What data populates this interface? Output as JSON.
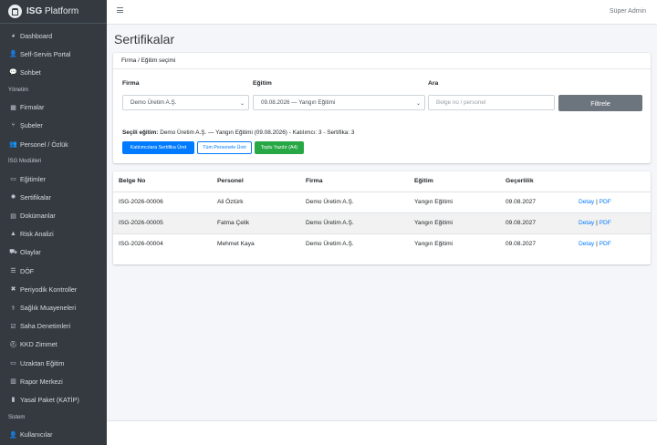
{
  "brand": {
    "name": "ISG",
    "suffix": "Platform"
  },
  "sidebar": {
    "entries": [
      {
        "type": "item",
        "icon": "dashboard-icon",
        "glyph": "◕",
        "label": "Dashboard"
      },
      {
        "type": "item",
        "icon": "user-cog-icon",
        "glyph": "👤",
        "label": "Self-Servis Portal"
      },
      {
        "type": "item",
        "icon": "chat-icon",
        "glyph": "💬",
        "label": "Sohbet"
      },
      {
        "type": "header",
        "label": "Yönetim"
      },
      {
        "type": "item",
        "icon": "building-icon",
        "glyph": "▦",
        "label": "Firmalar"
      },
      {
        "type": "item",
        "icon": "branch-icon",
        "glyph": "⑂",
        "label": "Şubeler"
      },
      {
        "type": "item",
        "icon": "users-icon",
        "glyph": "👥",
        "label": "Personel / Özlük"
      },
      {
        "type": "header",
        "label": "İSG Modülleri"
      },
      {
        "type": "item",
        "icon": "chalkboard-icon",
        "glyph": "▭",
        "label": "Eğitimler"
      },
      {
        "type": "item",
        "icon": "certificate-icon",
        "glyph": "✹",
        "label": "Sertifikalar"
      },
      {
        "type": "item",
        "icon": "document-icon",
        "glyph": "▤",
        "label": "Dokümanlar"
      },
      {
        "type": "item",
        "icon": "warning-icon",
        "glyph": "▲",
        "label": "Risk Analizi"
      },
      {
        "type": "item",
        "icon": "ambulance-icon",
        "glyph": "⛟",
        "label": "Olaylar"
      },
      {
        "type": "item",
        "icon": "list-icon",
        "glyph": "☰",
        "label": "DÖF"
      },
      {
        "type": "item",
        "icon": "tools-icon",
        "glyph": "✖",
        "label": "Periyodik Kontroller"
      },
      {
        "type": "item",
        "icon": "stethoscope-icon",
        "glyph": "⚕",
        "label": "Sağlık Muayeneleri"
      },
      {
        "type": "item",
        "icon": "clipboard-check-icon",
        "glyph": "☑",
        "label": "Saha Denetimleri"
      },
      {
        "type": "item",
        "icon": "hard-hat-icon",
        "glyph": "⛑",
        "label": "KKD Zimmet"
      },
      {
        "type": "item",
        "icon": "laptop-icon",
        "glyph": "▭",
        "label": "Uzaktan Eğitim"
      },
      {
        "type": "item",
        "icon": "chart-icon",
        "glyph": "▥",
        "label": "Rapor Merkezi"
      },
      {
        "type": "item",
        "icon": "file-icon",
        "glyph": "▮",
        "label": "Yasal Paket (KATİP)"
      },
      {
        "type": "header",
        "label": "Sistem"
      },
      {
        "type": "item",
        "icon": "user-gear-icon",
        "glyph": "👤",
        "label": "Kullanıcılar"
      }
    ]
  },
  "topbar": {
    "user": "Süper Admin"
  },
  "page": {
    "title": "Sertifikalar"
  },
  "filter": {
    "header": "Firma / Eğitim seçimi",
    "firma_label": "Firma",
    "firma_value": "Demo Üretim A.Ş.",
    "egitim_label": "Eğitim",
    "egitim_value": "09.08.2026 — Yangın Eğitimi",
    "ara_label": "Ara",
    "ara_placeholder": "Belge no / personel",
    "filter_button": "Filtrele"
  },
  "selection": {
    "label": "Seçili eğitim:",
    "text": "Demo Üretim A.Ş. — Yangın Eğitimi (09.08.2026) - Katılımcı: 3 - Sertifika: 3"
  },
  "actions": {
    "generate_participants": "Katılımcılara Sertifika Üret",
    "generate_all": "Tüm Personele Üret",
    "bulk_print": "Toplu Yazdır (A4)"
  },
  "table": {
    "columns": [
      "Belge No",
      "Personel",
      "Firma",
      "Eğitim",
      "Geçerlilik"
    ],
    "detail_label": "Detay",
    "pdf_label": "PDF",
    "rows": [
      [
        "ISG-2026-00006",
        "Ali Öztürk",
        "Demo Üretim A.Ş.",
        "Yangın Eğitimi",
        "09.08.2027"
      ],
      [
        "ISG-2026-00005",
        "Fatma Çelik",
        "Demo Üretim A.Ş.",
        "Yangın Eğitimi",
        "09.08.2027"
      ],
      [
        "ISG-2026-00004",
        "Mehmet Kaya",
        "Demo Üretim A.Ş.",
        "Yangın Eğitimi",
        "09.08.2027"
      ]
    ]
  }
}
